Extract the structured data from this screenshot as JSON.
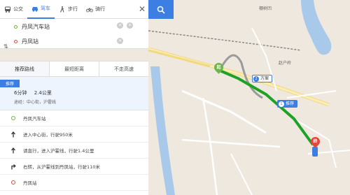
{
  "modes": [
    {
      "label": "公交",
      "active": false
    },
    {
      "label": "驾车",
      "active": true
    },
    {
      "label": "步行",
      "active": false
    },
    {
      "label": "骑行",
      "active": false
    }
  ],
  "close_symbol": "✕",
  "inputs": {
    "start_value": "丹凤汽车站",
    "end_value": "丹凤站",
    "swap_symbol": "⇅",
    "clear_symbol": "×",
    "add_symbol": "+"
  },
  "route_tabs": [
    "推荐路线",
    "最短距离",
    "不走高速"
  ],
  "summary": {
    "tag": "推荐",
    "time": "6分钟",
    "distance": "2.4公里",
    "via": "途经：中心街，沪霍线"
  },
  "steps": [
    {
      "icon": "start-ring-icon",
      "text": "丹凤汽车站"
    },
    {
      "icon": "straight-arrow-icon",
      "text": "进入中心街，行驶950米"
    },
    {
      "icon": "straight-arrow-icon",
      "text": "请直行，进入沪霍线，行驶1.4公里"
    },
    {
      "icon": "right-turn-icon",
      "text": "右转，从沪霍线到丹凤站，行驶110米"
    },
    {
      "icon": "end-ring-icon",
      "text": "丹凤站"
    }
  ],
  "map": {
    "labels": [
      "棚树凹",
      "赵户岭"
    ],
    "route_badges": [
      {
        "num": "1",
        "label": "推荐",
        "active": true
      },
      {
        "num": "2",
        "label": "方案",
        "active": false
      }
    ],
    "start_pin": "起",
    "end_pin": "终"
  },
  "colors": {
    "accent": "#3d7ee3",
    "route_green": "#1fa224",
    "start_green": "#6bb54a",
    "end_red": "#e0483c"
  }
}
